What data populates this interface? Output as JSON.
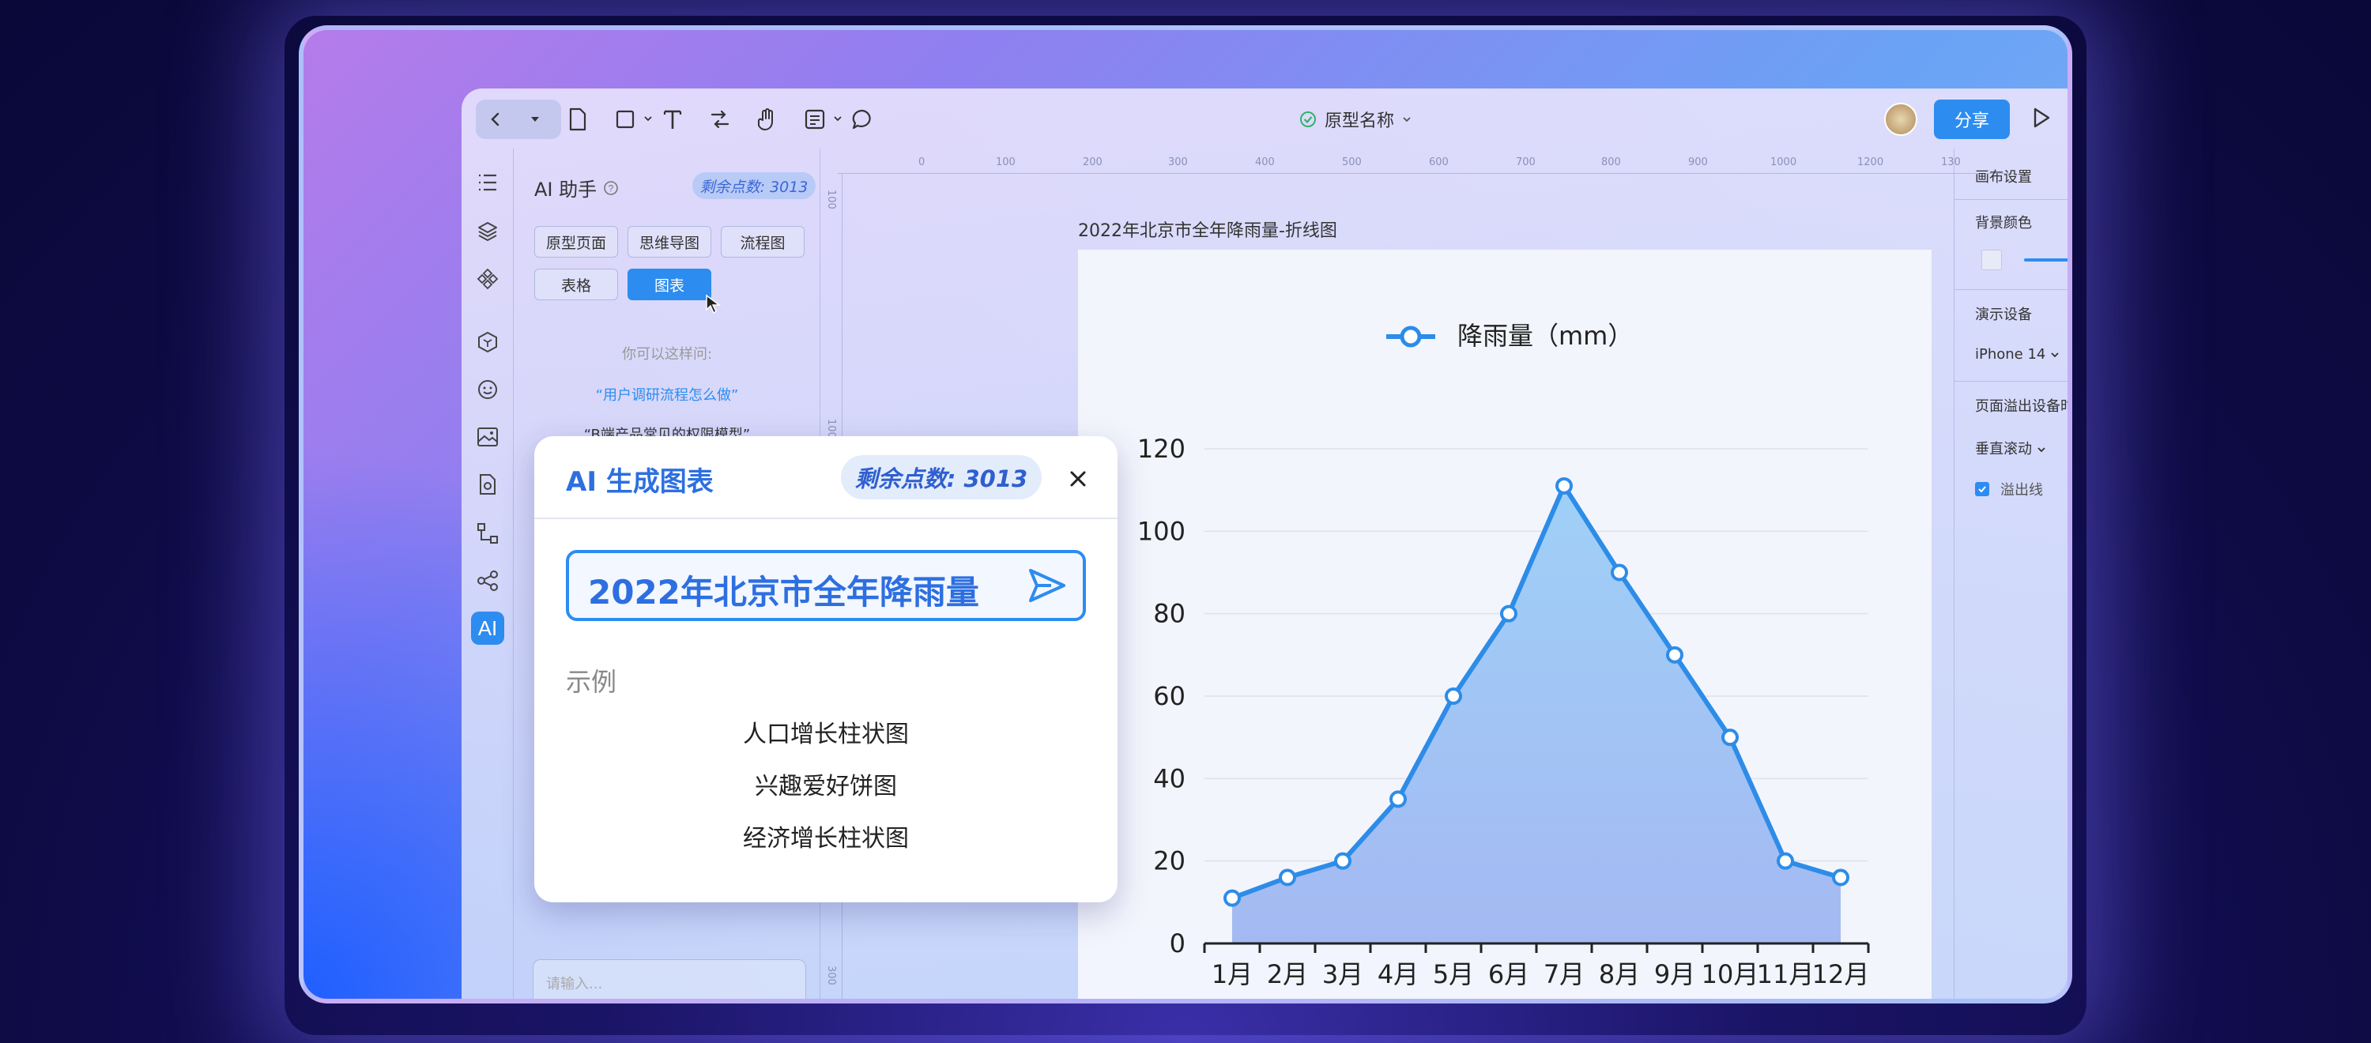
{
  "toolbar": {
    "doc_title": "原型名称",
    "share_label": "分享"
  },
  "ai_panel": {
    "title": "AI 助手",
    "credits": "剩余点数: 3013",
    "tabs": [
      {
        "label": "原型页面"
      },
      {
        "label": "思维导图"
      },
      {
        "label": "流程图"
      },
      {
        "label": "表格"
      },
      {
        "label": "图表",
        "active": true
      }
    ],
    "hint": "你可以这样问:",
    "suggestions": [
      "“用户调研流程怎么做”",
      "“B端产品常见的权限模型”"
    ],
    "input_placeholder": "请输入..."
  },
  "ruler": {
    "top": [
      "0",
      "100",
      "200",
      "300",
      "400",
      "500",
      "600",
      "700",
      "800",
      "900",
      "1000",
      "1200",
      "130"
    ],
    "left": [
      "100",
      "1000",
      "300"
    ]
  },
  "canvas": {
    "chart_caption": "2022年北京市全年降雨量-折线图"
  },
  "chart_data": {
    "type": "area",
    "categories": [
      "1月",
      "2月",
      "3月",
      "4月",
      "5月",
      "6月",
      "7月",
      "8月",
      "9月",
      "10月",
      "11月",
      "12月"
    ],
    "series": [
      {
        "name": "降雨量（mm）",
        "values": [
          11,
          16,
          20,
          35,
          60,
          80,
          111,
          90,
          70,
          50,
          20,
          16
        ]
      }
    ],
    "ylim": [
      0,
      120
    ],
    "yticks": [
      "0",
      "20",
      "40",
      "60",
      "80",
      "100",
      "120"
    ],
    "legend": "top-center",
    "grid": true,
    "colors": {
      "line": "#2d8ce8",
      "fill_top": "#9fd0f7",
      "fill_bottom": "#a4b9f2"
    }
  },
  "right_panel": {
    "canvas_settings": "画布设置",
    "bg_color": "背景颜色",
    "device_label": "演示设备",
    "device_value": "iPhone 14",
    "overflow_label": "页面溢出设备时",
    "scroll_value": "垂直滚动",
    "overflow_line": "溢出线"
  },
  "dialog": {
    "title": "AI 生成图表",
    "credits": "剩余点数: 3013",
    "input_value": "2022年北京市全年降雨量",
    "examples_label": "示例",
    "examples": [
      "人口增长柱状图",
      "兴趣爱好饼图",
      "经济增长柱状图"
    ]
  },
  "colors": {
    "accent": "#2d8cf0",
    "title_blue": "#2d6fe0"
  }
}
